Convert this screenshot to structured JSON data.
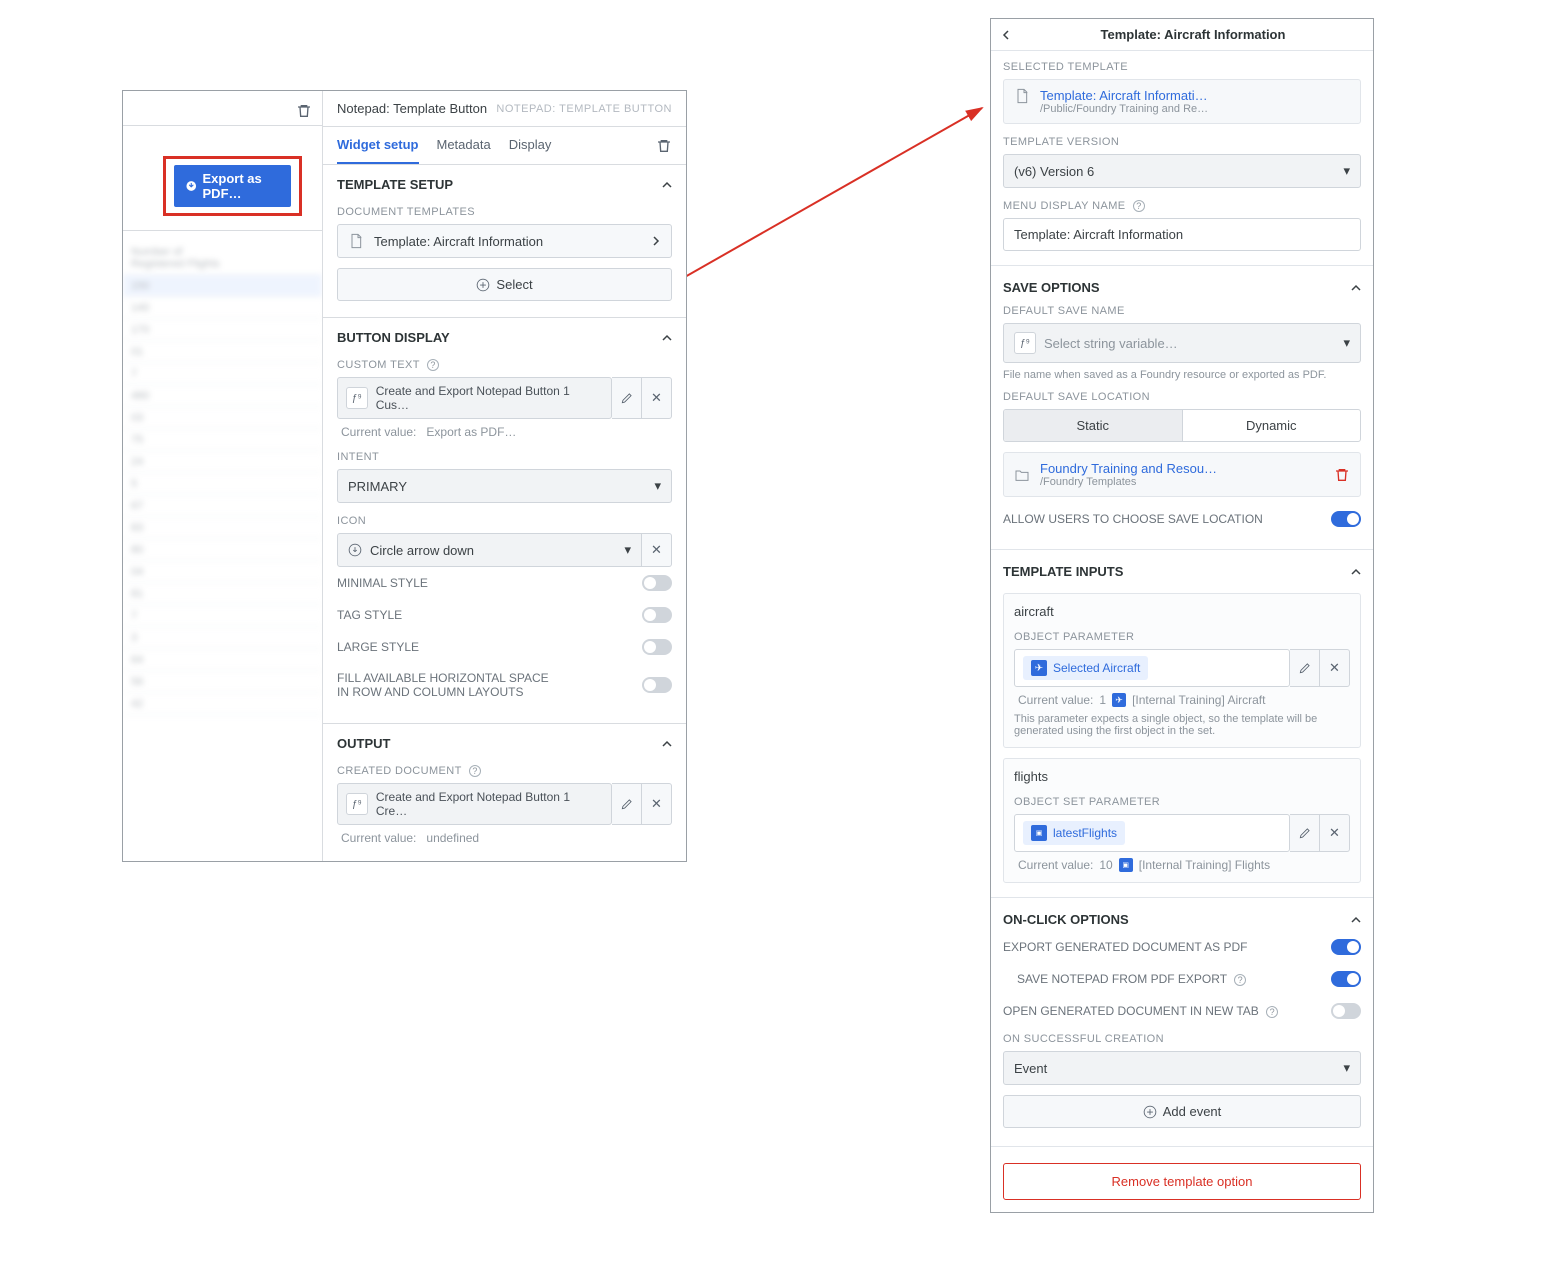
{
  "leftPanel": {
    "exportButton": "Export as PDF…",
    "header": {
      "title": "Notepad: Template Button",
      "code": "NOTEPAD: TEMPLATE BUTTON"
    },
    "tabs": {
      "widget": "Widget setup",
      "metadata": "Metadata",
      "display": "Display"
    },
    "templateSetup": {
      "heading": "TEMPLATE SETUP",
      "docTemplatesLabel": "DOCUMENT TEMPLATES",
      "item": "Template: Aircraft Information",
      "selectLabel": "Select"
    },
    "buttonDisplay": {
      "heading": "BUTTON DISPLAY",
      "customTextLabel": "CUSTOM TEXT",
      "customTextValue": "Create and Export Notepad Button 1 Cus…",
      "customTextCurrentLabel": "Current value:",
      "customTextCurrent": "Export as PDF…",
      "intentLabel": "INTENT",
      "intentValue": "PRIMARY",
      "iconLabel": "ICON",
      "iconValue": "Circle arrow down",
      "toggles": {
        "minimal": "MINIMAL STYLE",
        "tag": "TAG STYLE",
        "large": "LARGE STYLE",
        "fill": "FILL AVAILABLE HORIZONTAL SPACE IN ROW AND COLUMN LAYOUTS"
      }
    },
    "output": {
      "heading": "OUTPUT",
      "createdDocLabel": "CREATED DOCUMENT",
      "createdDocValue": "Create and Export Notepad Button 1 Cre…",
      "currentLabel": "Current value:",
      "currentValue": "undefined"
    }
  },
  "rightPanel": {
    "title": "Template: Aircraft Information",
    "selectedTemplateLabel": "SELECTED TEMPLATE",
    "template": {
      "title": "Template: Aircraft Informati…",
      "path": "/Public/Foundry Training and Re…"
    },
    "versionLabel": "TEMPLATE VERSION",
    "versionValue": "(v6) Version 6",
    "menuNameLabel": "MENU DISPLAY NAME",
    "menuNameValue": "Template: Aircraft Information",
    "saveOptions": {
      "heading": "SAVE OPTIONS",
      "defaultNameLabel": "DEFAULT SAVE NAME",
      "defaultNamePlaceholder": "Select string variable…",
      "defaultNameNote": "File name when saved as a Foundry resource or exported as PDF.",
      "locationLabel": "DEFAULT SAVE LOCATION",
      "segStatic": "Static",
      "segDynamic": "Dynamic",
      "folderTitle": "Foundry Training and Resou…",
      "folderPath": "/Foundry Templates",
      "allowChooseLabel": "ALLOW USERS TO CHOOSE SAVE LOCATION"
    },
    "templateInputs": {
      "heading": "TEMPLATE INPUTS",
      "aircraft": {
        "title": "aircraft",
        "paramLabel": "OBJECT PARAMETER",
        "chip": "Selected Aircraft",
        "currentLabel": "Current value:",
        "count": "1",
        "currentText": "[Internal Training] Aircraft",
        "note": "This parameter expects a single object, so the template will be generated using the first object in the set."
      },
      "flights": {
        "title": "flights",
        "paramLabel": "OBJECT SET PARAMETER",
        "chip": "latestFlights",
        "currentLabel": "Current value:",
        "count": "10",
        "currentText": "[Internal Training] Flights"
      }
    },
    "onClick": {
      "heading": "ON-CLICK OPTIONS",
      "exportPdf": "EXPORT GENERATED DOCUMENT AS PDF",
      "saveNotepad": "SAVE NOTEPAD FROM PDF EXPORT",
      "openNewTab": "OPEN GENERATED DOCUMENT IN NEW TAB",
      "onSuccessLabel": "ON SUCCESSFUL CREATION",
      "onSuccessValue": "Event",
      "addEvent": "Add event"
    },
    "removeLabel": "Remove template option"
  }
}
